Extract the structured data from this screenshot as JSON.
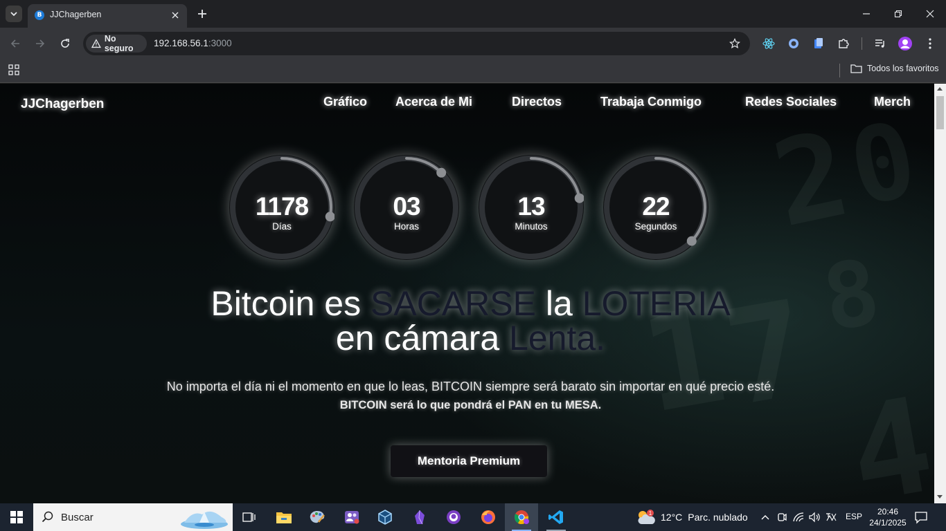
{
  "browser": {
    "tab_title": "JJChagerben",
    "tab_favicon_letter": "B",
    "security_label": "No seguro",
    "url_host": "192.168.56.1",
    "url_port": ":3000",
    "bookmarks_all": "Todos los favoritos",
    "profile_icon": "avatar-icon"
  },
  "site": {
    "logo": "JJChagerben",
    "nav": [
      {
        "label": "Gráfico"
      },
      {
        "label": "Acerca de Mi"
      },
      {
        "label": "Directos"
      },
      {
        "label": "Trabaja Conmigo"
      },
      {
        "label": "Redes Sociales"
      },
      {
        "label": "Merch"
      }
    ],
    "countdown": [
      {
        "value": "1178",
        "label": "Días",
        "fraction": 0.28
      },
      {
        "value": "03",
        "label": "Horas",
        "fraction": 0.125
      },
      {
        "value": "13",
        "label": "Minutos",
        "fraction": 0.22
      },
      {
        "value": "22",
        "label": "Segundos",
        "fraction": 0.37
      }
    ],
    "headline": {
      "line1_a": "Bitcoin es ",
      "line1_b": "SACARSE",
      "line1_c": " la ",
      "line1_d": "LOTERIA",
      "line2_a": "en cámara ",
      "line2_b": "Lenta."
    },
    "subtext": "No importa el día ni el momento en que lo leas, BITCOIN siempre será barato sin importar en qué precio esté.",
    "subtext_bold": "BITCOIN será lo que pondrá el PAN en tu MESA.",
    "cta_label": "Mentoria Premium",
    "accent_color": "#161a2c"
  },
  "taskbar": {
    "search_placeholder": "Buscar",
    "weather_temp": "12°C",
    "weather_desc": "Parc. nublado",
    "weather_badge": "1",
    "language": "ESP",
    "time": "20:46",
    "date": "24/1/2025"
  }
}
